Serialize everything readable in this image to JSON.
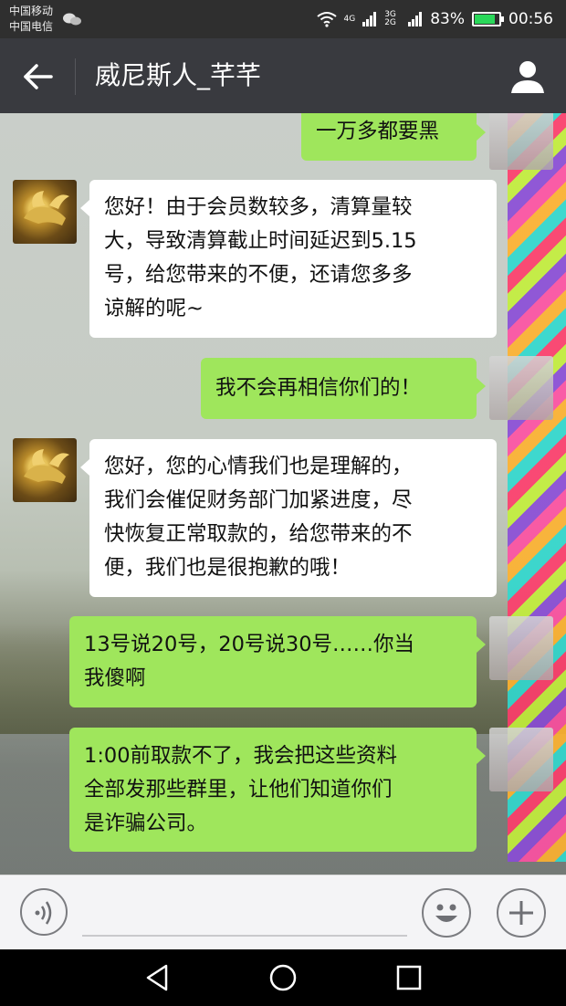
{
  "status_bar": {
    "carrier_1": "中国移动",
    "carrier_2": "中国电信",
    "network_1": "4G",
    "network_2": "3G 2G",
    "battery": "83%",
    "battery_level": 0.83,
    "time": "00:56"
  },
  "header": {
    "title": "威尼斯人_芊芊",
    "back_icon": "back-arrow-icon",
    "profile_icon": "person-icon"
  },
  "messages": [
    {
      "from": "me",
      "text": "一万多都要黑"
    },
    {
      "from": "them",
      "lines": [
        "您好！由于会员数较多，清算量较",
        "大，导致清算截止时间延迟到5.15",
        "号，给您带来的不便，还请您多多",
        "谅解的呢~"
      ]
    },
    {
      "from": "me",
      "text": "我不会再相信你们的！"
    },
    {
      "from": "them",
      "lines": [
        "您好，您的心情我们也是理解的，",
        "我们会催促财务部门加紧进度，尽",
        "快恢复正常取款的，给您带来的不",
        "便，我们也是很抱歉的哦！"
      ]
    },
    {
      "from": "me",
      "lines": [
        "13号说20号，20号说30号……你当",
        "我傻啊"
      ]
    },
    {
      "from": "me",
      "lines": [
        "1:00前取款不了，我会把这些资料",
        "全部发那些群里，让他们知道你们",
        "是诈骗公司。"
      ]
    }
  ],
  "input_bar": {
    "voice_icon": "voice-input-icon",
    "emoji_icon": "emoji-icon",
    "plus_icon": "plus-icon"
  },
  "nav_bar": {
    "back_icon": "nav-back-icon",
    "home_icon": "nav-home-icon",
    "recent_icon": "nav-recent-apps-icon"
  },
  "colors": {
    "header_bg": "#393a3f",
    "outgoing_bubble": "#9fe65c",
    "incoming_bubble": "#ffffff"
  }
}
